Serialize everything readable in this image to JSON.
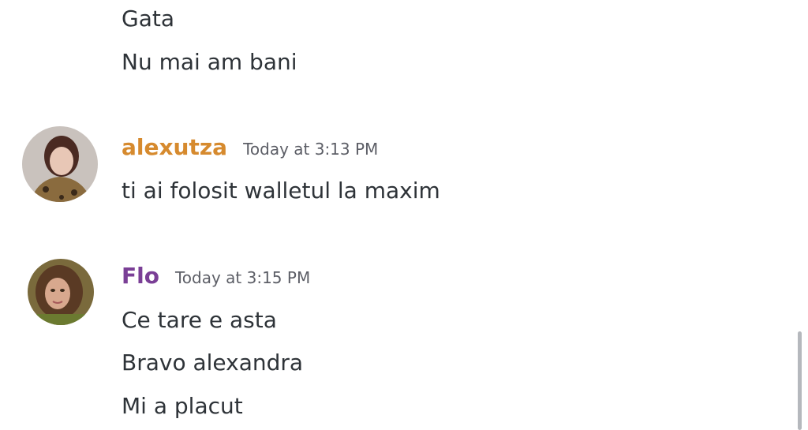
{
  "messages_continued": [
    {
      "text": "Gata"
    },
    {
      "text": "Nu mai am bani"
    }
  ],
  "groups": [
    {
      "username": "alexutza",
      "username_color": "#d68a2e",
      "timestamp": "Today at 3:13 PM",
      "avatar_icon": "user-avatar-alexutza",
      "lines": [
        "ti ai folosit walletul la maxim"
      ]
    },
    {
      "username": "Flo",
      "username_color": "#7a3f96",
      "timestamp": "Today at 3:15 PM",
      "avatar_icon": "user-avatar-flo",
      "lines": [
        "Ce tare e asta",
        "Bravo alexandra",
        "Mi a placut"
      ]
    }
  ]
}
